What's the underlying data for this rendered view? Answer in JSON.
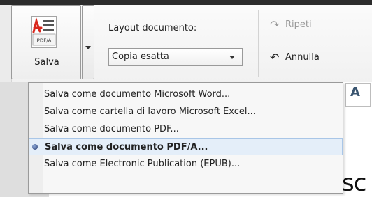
{
  "ribbon": {
    "save_button": {
      "label": "Salva",
      "icon": "pdf-a-icon",
      "icon_caption": "PDF/A"
    },
    "layout": {
      "label": "Layout documento:",
      "selected": "Copia esatta"
    },
    "redo": {
      "label": "Ripeti",
      "icon": "redo-icon"
    },
    "undo": {
      "label": "Annulla",
      "icon": "undo-icon"
    }
  },
  "menu": {
    "items": [
      {
        "label": "Salva come documento Microsoft Word..."
      },
      {
        "label": "Salva come cartella di lavoro Microsoft Excel..."
      },
      {
        "label": "Salva come documento PDF..."
      },
      {
        "label": "Salva come documento PDF/A..."
      },
      {
        "label": "Salva come Electronic Publication (EPUB)..."
      }
    ]
  },
  "background": {
    "field_text": "A",
    "large_text": "sc"
  }
}
